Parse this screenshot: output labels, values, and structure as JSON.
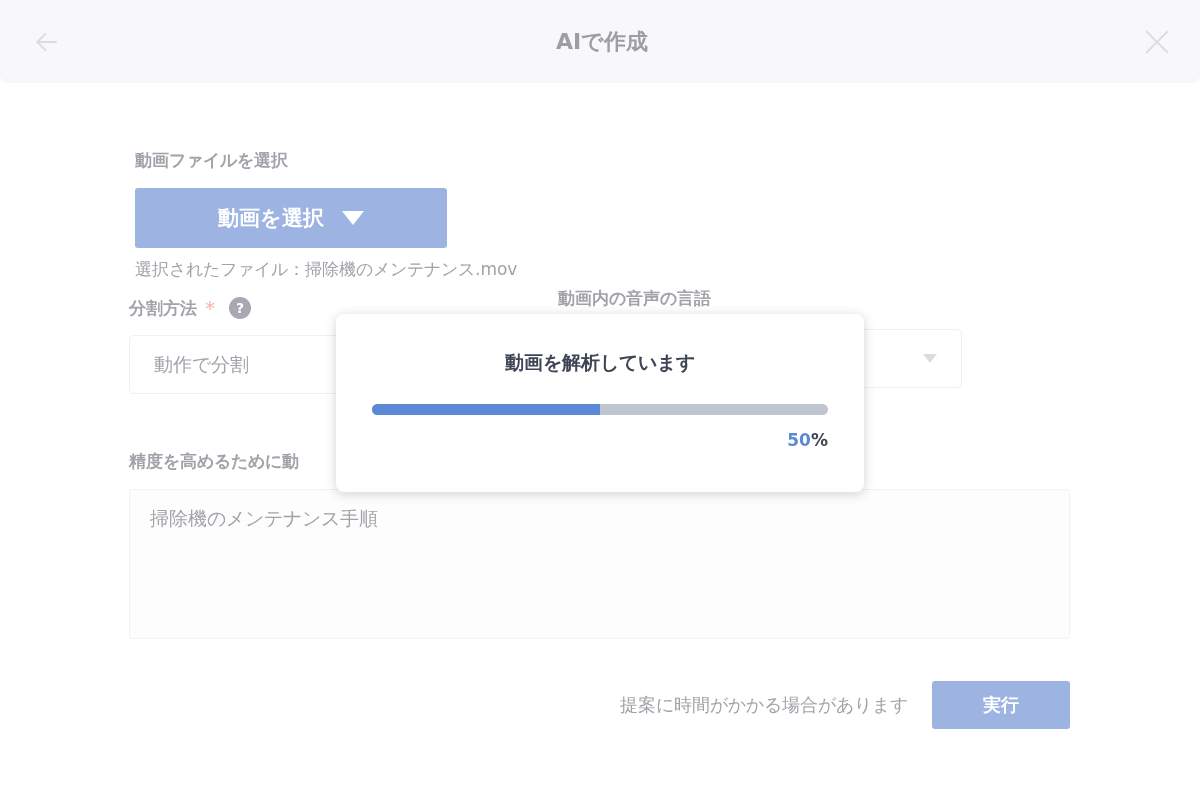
{
  "header": {
    "title": "AIで作成"
  },
  "form": {
    "file_label": "動画ファイルを選択",
    "file_button": "動画を選択",
    "selected_file": "選択されたファイル：掃除機のメンテナンス.mov",
    "split_label": "分割方法",
    "split_required": "*",
    "split_help": "?",
    "split_value": "動作で分割",
    "language_label": "動画内の音声の言語",
    "description_label": "精度を高めるために動",
    "description_placeholder": "掃除機のメンテナンス手順",
    "note": "提案に時間がかかる場合があります",
    "run_button": "実行"
  },
  "progress_dialog": {
    "title": "動画を解析しています",
    "level": 0.5,
    "percent": "50",
    "percent_sign": "%"
  }
}
